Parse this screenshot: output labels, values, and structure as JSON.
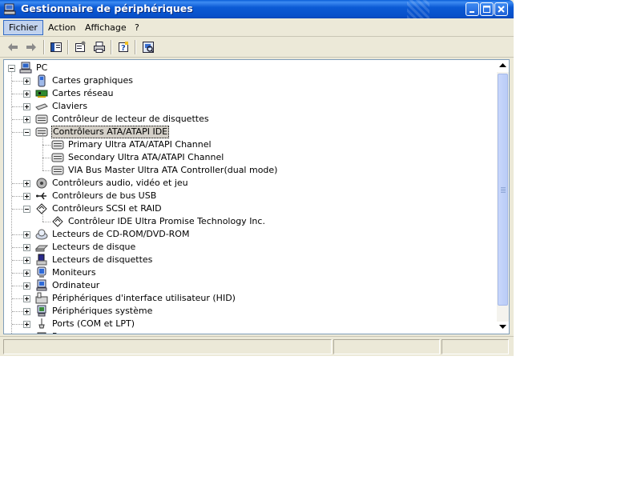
{
  "window": {
    "title": "Gestionnaire de périphériques",
    "colors": {
      "titlebar": "#0b5ad5",
      "face": "#ece9d8",
      "selection": "#d4d0c8"
    }
  },
  "menu": {
    "items": [
      {
        "label": "Fichier",
        "active": true
      },
      {
        "label": "Action"
      },
      {
        "label": "Affichage"
      },
      {
        "label": "?"
      }
    ]
  },
  "toolbar": {
    "buttons": [
      {
        "icon": "back-arrow-icon"
      },
      {
        "icon": "forward-arrow-icon"
      },
      {
        "icon": "show-hide-tree-icon"
      },
      {
        "icon": "properties-icon"
      },
      {
        "icon": "print-icon"
      },
      {
        "icon": "help-icon"
      },
      {
        "icon": "scan-hardware-icon"
      }
    ]
  },
  "tree": {
    "root": {
      "label": "PC",
      "icon": "computer-icon"
    },
    "items": [
      {
        "label": "Cartes graphiques",
        "icon": "display-adapter-icon",
        "expanded": false
      },
      {
        "label": "Cartes réseau",
        "icon": "network-card-icon",
        "expanded": false
      },
      {
        "label": "Claviers",
        "icon": "keyboard-icon",
        "expanded": false
      },
      {
        "label": "Contrôleur de lecteur de disquettes",
        "icon": "floppy-controller-icon",
        "expanded": false
      },
      {
        "label": "Contrôleurs ATA/ATAPI IDE",
        "icon": "ide-controller-icon",
        "expanded": true,
        "selected": true,
        "children": [
          {
            "label": "Primary Ultra ATA/ATAPI Channel",
            "icon": "ide-channel-icon"
          },
          {
            "label": "Secondary Ultra ATA/ATAPI Channel",
            "icon": "ide-channel-icon"
          },
          {
            "label": "VIA Bus Master Ultra ATA Controller(dual mode)",
            "icon": "ide-channel-icon"
          }
        ]
      },
      {
        "label": "Contrôleurs audio, vidéo et jeu",
        "icon": "audio-icon",
        "expanded": false
      },
      {
        "label": "Contrôleurs de bus USB",
        "icon": "usb-icon",
        "expanded": false
      },
      {
        "label": "Contrôleurs SCSI et RAID",
        "icon": "scsi-icon",
        "expanded": true,
        "children": [
          {
            "label": "Contrôleur IDE Ultra Promise Technology Inc.",
            "icon": "scsi-device-icon"
          }
        ]
      },
      {
        "label": "Lecteurs de CD-ROM/DVD-ROM",
        "icon": "cdrom-icon",
        "expanded": false
      },
      {
        "label": "Lecteurs de disque",
        "icon": "disk-drive-icon",
        "expanded": false
      },
      {
        "label": "Lecteurs de disquettes",
        "icon": "floppy-drive-icon",
        "expanded": false
      },
      {
        "label": "Moniteurs",
        "icon": "monitor-icon",
        "expanded": false
      },
      {
        "label": "Ordinateur",
        "icon": "computer-small-icon",
        "expanded": false
      },
      {
        "label": "Périphériques d'interface utilisateur (HID)",
        "icon": "hid-icon",
        "expanded": false
      },
      {
        "label": "Périphériques système",
        "icon": "system-devices-icon",
        "expanded": false
      },
      {
        "label": "Ports (COM et LPT)",
        "icon": "ports-icon",
        "expanded": false
      },
      {
        "label": "Processeurs",
        "icon": "processor-icon",
        "expanded": false
      }
    ]
  }
}
